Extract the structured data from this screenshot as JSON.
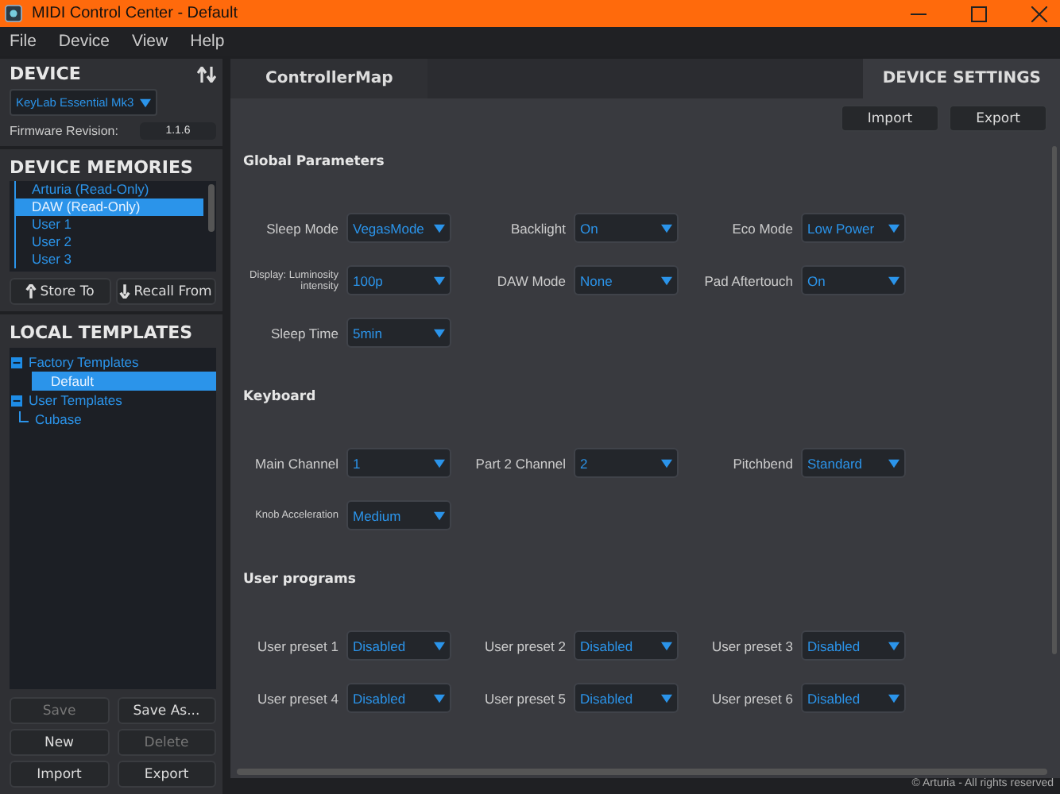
{
  "window": {
    "title": "MIDI Control Center - Default"
  },
  "menu": [
    "File",
    "Device",
    "View",
    "Help"
  ],
  "device": {
    "heading": "DEVICE",
    "selector": "KeyLab Essential Mk3",
    "firmware_label": "Firmware Revision:",
    "firmware_value": "1.1.6"
  },
  "device_memories": {
    "heading": "DEVICE MEMORIES",
    "items": [
      {
        "label": "Arturia (Read-Only)",
        "selected": false
      },
      {
        "label": "DAW (Read-Only)",
        "selected": true
      },
      {
        "label": "User 1",
        "selected": false
      },
      {
        "label": "User 2",
        "selected": false
      },
      {
        "label": "User 3",
        "selected": false
      }
    ],
    "buttons": [
      "Store To",
      "Recall From"
    ]
  },
  "local_templates": {
    "heading": "LOCAL TEMPLATES",
    "tree": [
      {
        "label": "Factory Templates",
        "expanded": true,
        "selected": false,
        "children": [
          {
            "label": "Default",
            "selected": true
          }
        ]
      },
      {
        "label": "User Templates",
        "expanded": true,
        "selected": false,
        "children": [
          {
            "label": "Cubase",
            "selected": false
          }
        ]
      }
    ]
  },
  "template_buttons": [
    {
      "label": "Save",
      "disabled": true
    },
    {
      "label": "Save As...",
      "disabled": false
    },
    {
      "label": "New",
      "disabled": false
    },
    {
      "label": "Delete",
      "disabled": true
    },
    {
      "label": "Import",
      "disabled": false
    },
    {
      "label": "Export",
      "disabled": false
    }
  ],
  "tabs": [
    {
      "label": "ControllerMap",
      "selected": false
    },
    {
      "label": "DEVICE SETTINGS",
      "selected": true
    }
  ],
  "settings_buttons": [
    "Import",
    "Export"
  ],
  "sections": [
    {
      "title": "Global Parameters",
      "rows": [
        [
          {
            "label": "Sleep Mode",
            "value": "VegasMode"
          },
          {
            "label": "Backlight",
            "value": "On"
          },
          {
            "label": "Eco Mode",
            "value": "Low Power"
          }
        ],
        [
          {
            "label": "Display: Luminosity intensity",
            "kind": "compact",
            "value": "100p"
          },
          {
            "label": "DAW Mode",
            "value": "None"
          },
          {
            "label": "Pad Aftertouch",
            "value": "On"
          }
        ],
        [
          {
            "label": "Sleep Time",
            "value": "5min"
          }
        ]
      ]
    },
    {
      "title": "Keyboard",
      "rows": [
        [
          {
            "label": "Main Channel",
            "value": "1"
          },
          {
            "label": "Part 2 Channel",
            "value": "2"
          },
          {
            "label": "Pitchbend",
            "value": "Standard"
          }
        ],
        [
          {
            "label": "Knob Acceleration",
            "kind": "compact",
            "value": "Medium"
          }
        ]
      ]
    },
    {
      "title": "User programs",
      "rows": [
        [
          {
            "label": "User preset 1",
            "value": "Disabled"
          },
          {
            "label": "User preset 2",
            "value": "Disabled"
          },
          {
            "label": "User preset 3",
            "value": "Disabled"
          }
        ],
        [
          {
            "label": "User preset 4",
            "value": "Disabled"
          },
          {
            "label": "User preset 5",
            "value": "Disabled"
          },
          {
            "label": "User preset 6",
            "value": "Disabled"
          }
        ]
      ]
    }
  ],
  "footer": "© Arturia - All rights reserved"
}
